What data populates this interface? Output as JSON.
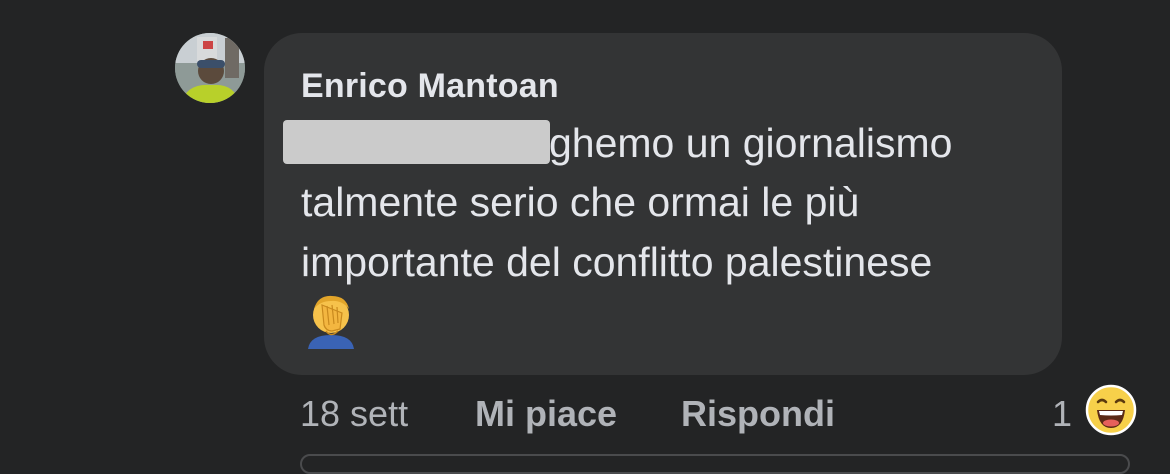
{
  "comment": {
    "author": "Enrico Mantoan",
    "text_lines": [
      "ghemo un giornalismo",
      "talmente serio che ormai le più",
      "importante del conflitto palestinese"
    ],
    "emoji": "facepalm-emoji"
  },
  "actions": {
    "time": "18 sett",
    "like_label": "Mi piace",
    "reply_label": "Rispondi"
  },
  "reactions": {
    "count": "1",
    "icon": "haha-reaction-icon"
  },
  "colors": {
    "background": "#232425",
    "bubble": "#333435",
    "text": "#e4e6eb",
    "secondary_text": "#b0b3b8",
    "redaction": "#cbcbcb"
  }
}
